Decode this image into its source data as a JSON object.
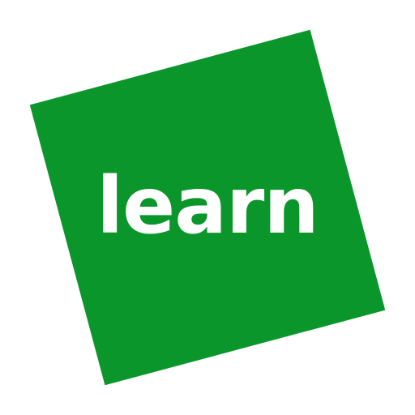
{
  "logo": {
    "word": "learn",
    "background_color": "#ffffff",
    "square_color": "#0a962a",
    "text_color": "#ffffff",
    "rotation_deg": -15
  }
}
